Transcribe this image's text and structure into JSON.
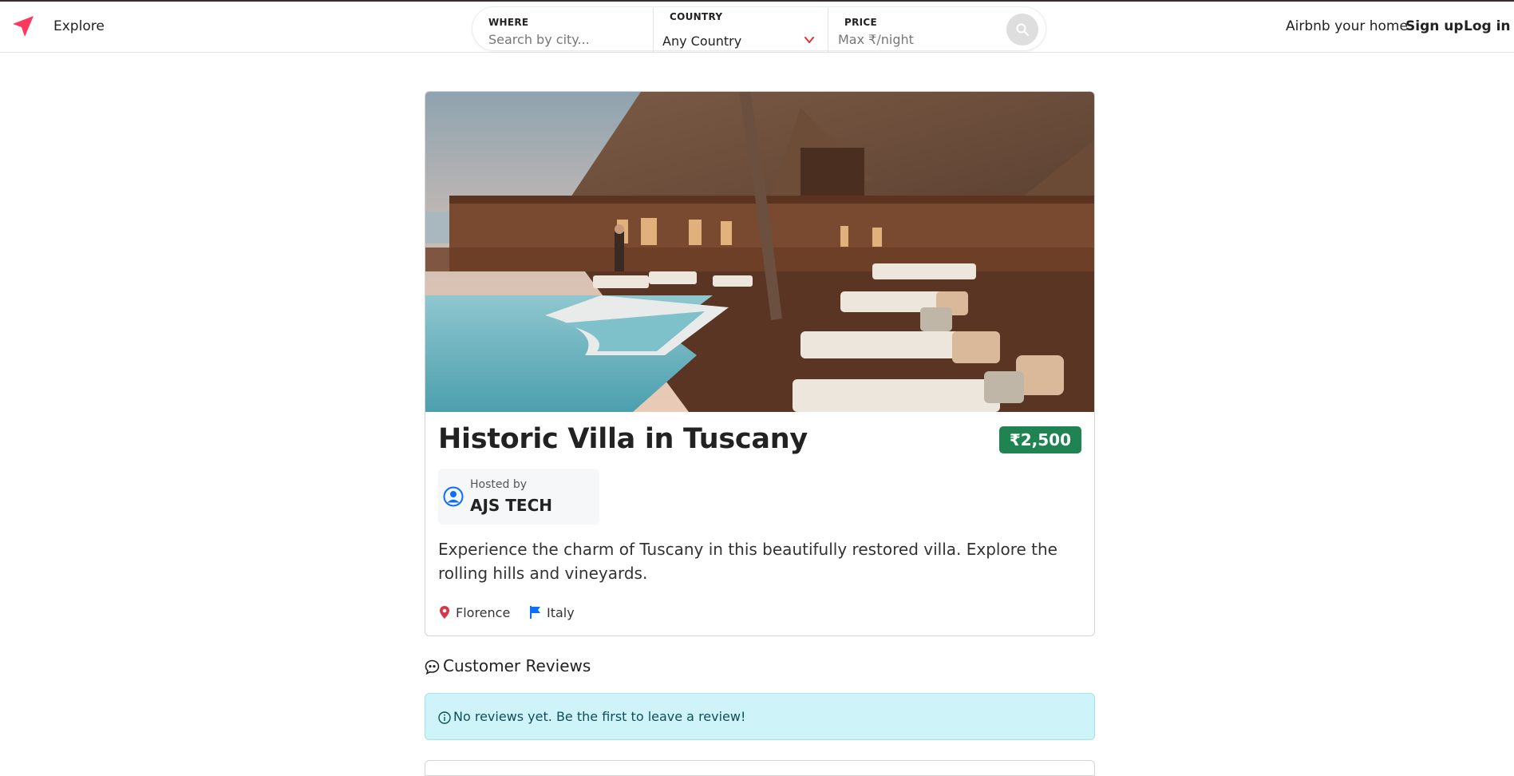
{
  "nav": {
    "brand_icon": "navigation-arrow-icon",
    "explore_label": "Explore",
    "host_link": "Airbnb your home",
    "signup_label": "Sign up",
    "login_label": "Log in"
  },
  "search": {
    "where_label": "WHERE",
    "where_placeholder": "Search by city...",
    "country_label": "COUNTRY",
    "country_value": "Any Country",
    "price_label": "PRICE",
    "price_placeholder": "Max ₹/night",
    "button_icon": "search-icon"
  },
  "listing": {
    "title": "Historic Villa in Tuscany",
    "price": "₹2,500",
    "host_caption": "Hosted by",
    "host_name": "AJS TECH",
    "description": "Experience the charm of Tuscany in this beautifully restored villa. Explore the rolling hills and vineyards.",
    "city": "Florence",
    "country": "Italy"
  },
  "reviews": {
    "heading": "Customer Reviews",
    "empty_message": "No reviews yet. Be the first to leave a review!"
  },
  "colors": {
    "brand": "#ff385c",
    "price_badge": "#1f8452",
    "alert_bg": "#cef3f9",
    "flag": "#0d6efd",
    "pin": "#dc3545"
  }
}
